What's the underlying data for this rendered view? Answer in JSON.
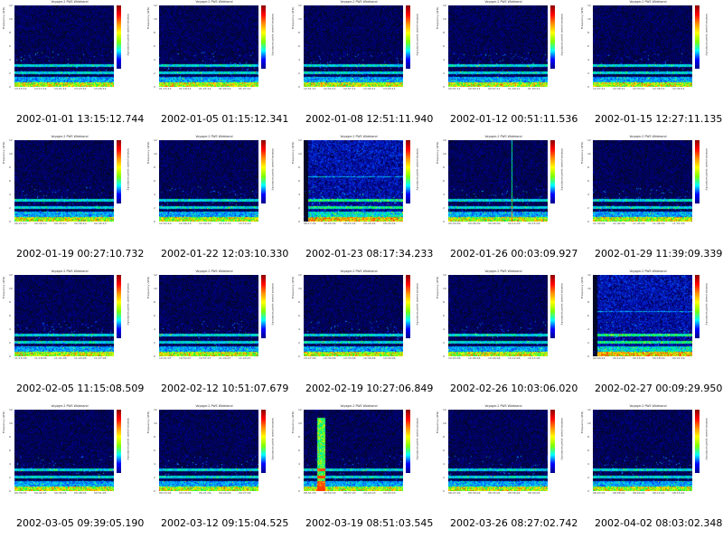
{
  "chart_data": [
    {
      "type": "heatmap",
      "caption": "2002-01-01 13:15:12.744",
      "xticks": [
        "13:15:12",
        "13:17:12",
        "13:21:12",
        "13:23:12",
        "13:26:12"
      ],
      "variant": "lines"
    },
    {
      "type": "heatmap",
      "caption": "2002-01-05 01:15:12.341",
      "xticks": [
        "01:15:12",
        "01:18:12",
        "01:21:12",
        "01:24:12",
        "01:27:12"
      ],
      "variant": "lines"
    },
    {
      "type": "heatmap",
      "caption": "2002-01-08 12:51:11.940",
      "xticks": [
        "12:51:11",
        "12:54:11",
        "12:57:11",
        "13:00:11",
        "13:03:11"
      ],
      "variant": "lines"
    },
    {
      "type": "heatmap",
      "caption": "2002-01-12 00:51:11.536",
      "xticks": [
        "00:51:11",
        "00:54:11",
        "00:57:11",
        "01:00:11",
        "01:03:11"
      ],
      "variant": "lines"
    },
    {
      "type": "heatmap",
      "caption": "2002-01-15 12:27:11.135",
      "xticks": [
        "12:27:11",
        "12:30:11",
        "12:33:11",
        "12:36:11",
        "12:39:11"
      ],
      "variant": "lines"
    },
    {
      "type": "heatmap",
      "caption": "2002-01-19 00:27:10.732",
      "xticks": [
        "00:27:10",
        "00:30:10",
        "00:33:10",
        "00:36:10",
        "00:39:10"
      ],
      "variant": "lines"
    },
    {
      "type": "heatmap",
      "caption": "2002-01-22 12:03:10.330",
      "xticks": [
        "12:03:10",
        "12:06:10",
        "12:09:10",
        "12:12:10",
        "12:15:10"
      ],
      "variant": "lines"
    },
    {
      "type": "heatmap",
      "caption": "2002-01-23 08:17:34.233",
      "xticks": [
        "08:17:34",
        "08:20:34",
        "08:23:34",
        "08:26:34",
        "08:29:34"
      ],
      "variant": "noisy"
    },
    {
      "type": "heatmap",
      "caption": "2002-01-26 00:03:09.927",
      "xticks": [
        "00:03:09",
        "00:06:09",
        "00:09:09",
        "00:12:09",
        "00:15:09"
      ],
      "variant": "spike"
    },
    {
      "type": "heatmap",
      "caption": "2002-01-29 11:39:09.339",
      "xticks": [
        "11:39:09",
        "11:42:09",
        "11:45:09",
        "11:48:09",
        "11:51:09"
      ],
      "variant": "lines"
    },
    {
      "type": "heatmap",
      "caption": "2002-02-05 11:15:08.509",
      "xticks": [
        "11:15:08",
        "11:18:08",
        "11:21:08",
        "11:24:08",
        "11:27:08"
      ],
      "variant": "lines"
    },
    {
      "type": "heatmap",
      "caption": "2002-02-12 10:51:07.679",
      "xticks": [
        "10:51:07",
        "10:54:07",
        "10:57:07",
        "11:00:07",
        "11:03:07"
      ],
      "variant": "lines"
    },
    {
      "type": "heatmap",
      "caption": "2002-02-19 10:27:06.849",
      "xticks": [
        "10:27:06",
        "10:30:06",
        "10:33:06",
        "10:36:06",
        "10:39:06"
      ],
      "variant": "lines"
    },
    {
      "type": "heatmap",
      "caption": "2002-02-26 10:03:06.020",
      "xticks": [
        "10:03:06",
        "10:06:06",
        "10:09:06",
        "10:12:06",
        "10:15:06"
      ],
      "variant": "lines"
    },
    {
      "type": "heatmap",
      "caption": "2002-02-27 00:09:29.950",
      "xticks": [
        "00:09:29",
        "00:12:29",
        "00:15:29",
        "00:18:29",
        "00:21:29"
      ],
      "variant": "noisy"
    },
    {
      "type": "heatmap",
      "caption": "2002-03-05 09:39:05.190",
      "xticks": [
        "09:39:05",
        "09:42:05",
        "09:45:05",
        "09:48:05",
        "09:51:05"
      ],
      "variant": "lines"
    },
    {
      "type": "heatmap",
      "caption": "2002-03-12 09:15:04.525",
      "xticks": [
        "09:15:04",
        "09:18:04",
        "09:21:04",
        "09:24:04",
        "09:27:04"
      ],
      "variant": "lines"
    },
    {
      "type": "heatmap",
      "caption": "2002-03-19 08:51:03.545",
      "xticks": [
        "08:51:03",
        "08:54:03",
        "08:57:03",
        "09:00:03",
        "09:03:03"
      ],
      "variant": "burst"
    },
    {
      "type": "heatmap",
      "caption": "2002-03-26 08:27:02.742",
      "xticks": [
        "08:27:02",
        "08:30:02",
        "08:33:02",
        "08:36:02",
        "08:39:02"
      ],
      "variant": "lines"
    },
    {
      "type": "heatmap",
      "caption": "2002-04-02 08:03:02.348",
      "xticks": [
        "08:03:02",
        "08:06:02",
        "08:09:02",
        "08:12:02",
        "08:15:02"
      ],
      "variant": "lines"
    }
  ],
  "panel_title_prefix": "Voyager-2 PWS Wideband",
  "ylabel": "Frequency (kHz)",
  "cbar_label": "relative power spectral density",
  "yticks": [
    "12",
    "10",
    "8",
    "6",
    "4",
    "2",
    "0"
  ]
}
